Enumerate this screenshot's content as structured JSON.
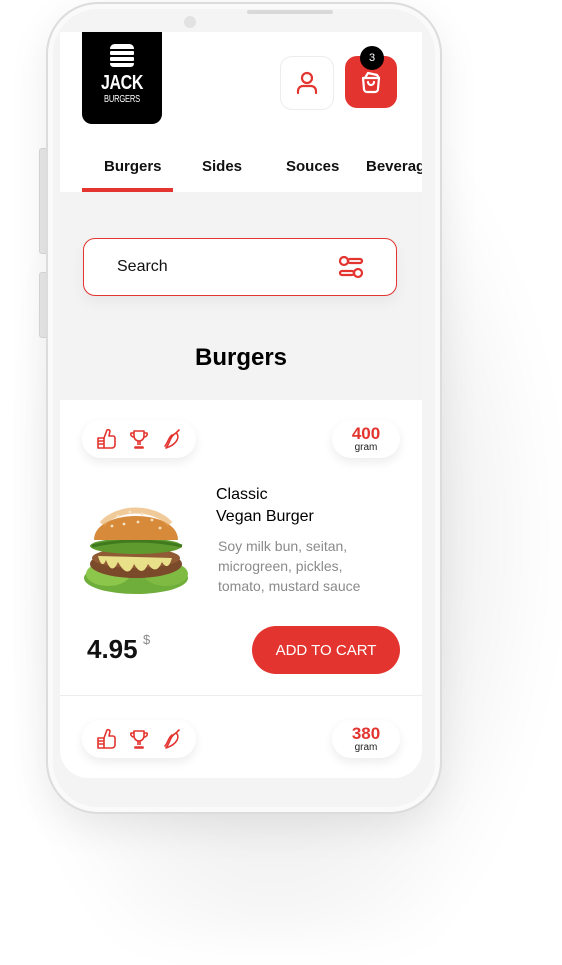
{
  "brand": {
    "line1": "JACK",
    "line2": "BURGERS"
  },
  "header": {
    "user_icon": "user-icon",
    "cart_icon": "shopping-bag-icon",
    "cart_count": "3"
  },
  "tabs": [
    {
      "label": "Burgers",
      "active": true
    },
    {
      "label": "Sides",
      "active": false
    },
    {
      "label": "Souces",
      "active": false
    },
    {
      "label": "Beverages",
      "active": false
    }
  ],
  "search": {
    "placeholder": "Search",
    "filter_icon": "filter-sliders-icon"
  },
  "section_title": "Burgers",
  "products": [
    {
      "badges": [
        "thumbs-up-icon",
        "trophy-icon",
        "chili-pepper-icon"
      ],
      "weight": "400",
      "weight_unit": "gram",
      "name_line1": "Classic",
      "name_line2": "Vegan Burger",
      "description_lines": [
        "Soy milk bun, seitan,",
        "microgreen, pickles,",
        "tomato, mustard sauce"
      ],
      "price": "4.95",
      "currency": "$",
      "add_label": "ADD TO CART"
    },
    {
      "badges": [
        "thumbs-up-icon",
        "trophy-icon",
        "chili-pepper-icon"
      ],
      "weight": "380",
      "weight_unit": "gram"
    }
  ],
  "colors": {
    "accent": "#e3342f",
    "background": "#f3f3f3",
    "text": "#111111",
    "muted": "#8a8a8a"
  }
}
